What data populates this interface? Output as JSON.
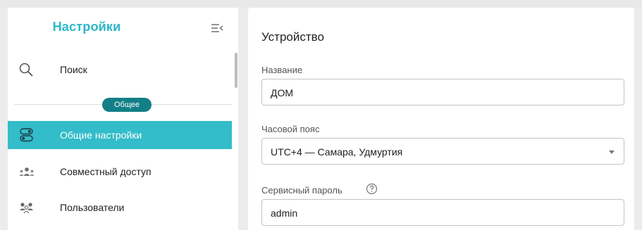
{
  "sidebar": {
    "title": "Настройки",
    "search": {
      "label": "Поиск",
      "icon": "search-icon"
    },
    "section_label": "Общее",
    "items": [
      {
        "label": "Общие настройки",
        "icon": "settings-toggles-icon",
        "active": true
      },
      {
        "label": "Совместный доступ",
        "icon": "shared-access-icon",
        "active": false
      },
      {
        "label": "Пользователи",
        "icon": "users-icon",
        "active": false
      }
    ]
  },
  "panel": {
    "title": "Устройство",
    "fields": {
      "name": {
        "label": "Название",
        "value": "ДОМ"
      },
      "timezone": {
        "label": "Часовой пояс",
        "value": "UTC+4 — Самара, Удмуртия"
      },
      "service_password": {
        "label": "Сервисный пароль",
        "value": "admin"
      }
    }
  },
  "colors": {
    "accent": "#33bcc9",
    "title_accent": "#2bb7c4",
    "pill": "#137f86",
    "background": "#ececec"
  }
}
